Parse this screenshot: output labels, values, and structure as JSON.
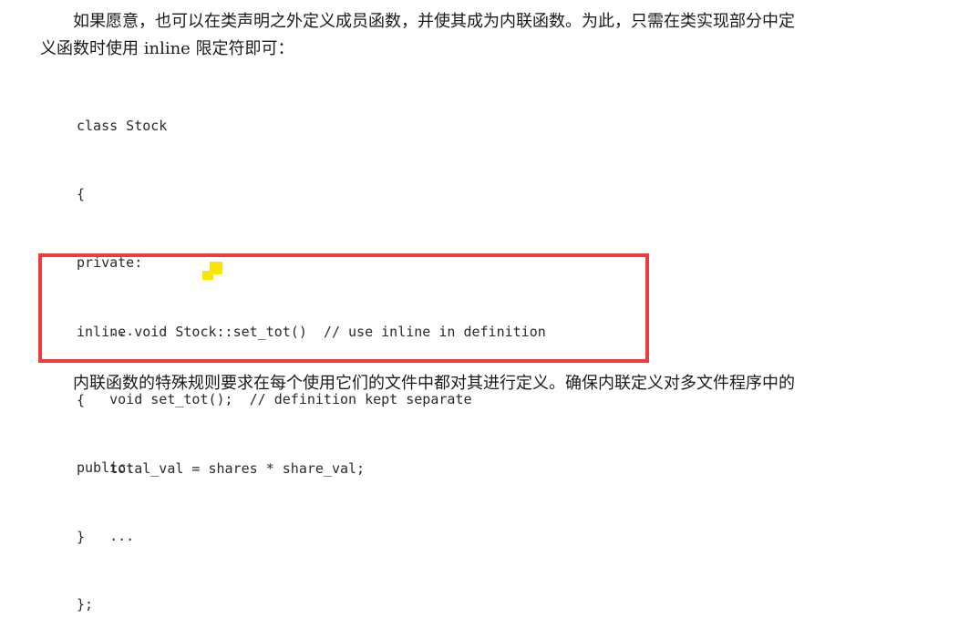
{
  "paragraphs": {
    "top_line1": "如果愿意，也可以在类声明之外定义成员函数，并使其成为内联函数。为此，只需在类实现部分中定",
    "top_line2": "义函数时使用 inline 限定符即可：",
    "bottom_line": "内联函数的特殊规则要求在每个使用它们的文件中都对其进行定义。确保内联定义对多文件程序中的"
  },
  "code_block_1": {
    "lines": [
      "class Stock",
      "{",
      "private:",
      "    ...",
      "    void set_tot();  // definition kept separate",
      "public:",
      "    ...",
      "};"
    ]
  },
  "code_block_2": {
    "lines": [
      "inline void Stock::set_tot()  // use inline in definition",
      "{",
      "    total_val = shares * share_val;",
      "}"
    ]
  },
  "colors": {
    "highlight_border": "#ee3b3b",
    "cursor_mark": "#f7e600"
  },
  "icons": {
    "cursor": "highlighter-cursor-icon"
  }
}
